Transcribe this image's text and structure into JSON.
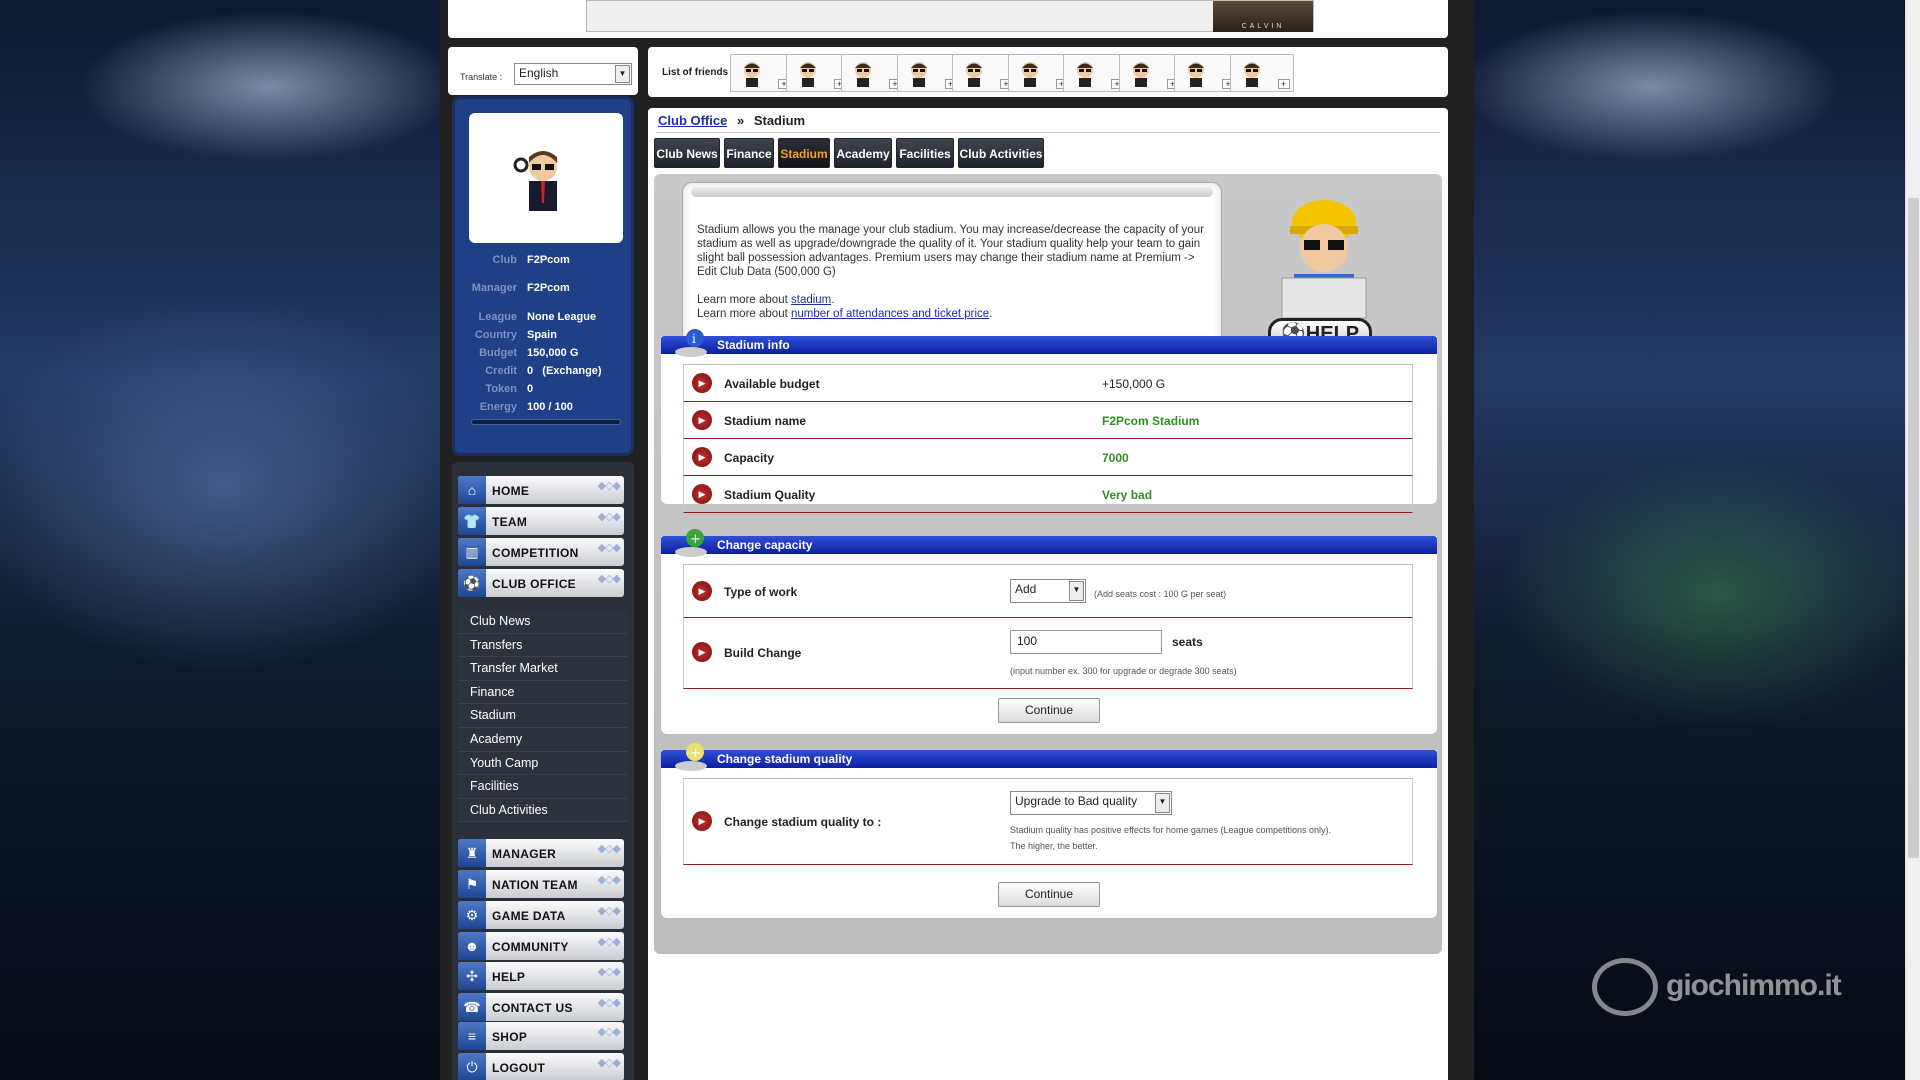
{
  "banner": {
    "ad_caption": "CALVIN"
  },
  "translate": {
    "label": "Translate :",
    "language": "English"
  },
  "profile": {
    "fields": [
      {
        "key": "Club",
        "value": "F2Pcom"
      },
      {
        "key": "Manager",
        "value": "F2Pcom"
      },
      {
        "key": "League",
        "value": "None League"
      },
      {
        "key": "Country",
        "value": "Spain"
      },
      {
        "key": "Budget",
        "value": "150,000 G"
      },
      {
        "key": "Credit",
        "value": "0   (Exchange)"
      },
      {
        "key": "Token",
        "value": "0"
      },
      {
        "key": "Energy",
        "value": "100 / 100"
      }
    ],
    "energy_level": 1.0
  },
  "menu": {
    "top": [
      {
        "label": "HOME",
        "icon": "home-icon"
      },
      {
        "label": "TEAM",
        "icon": "shirt-icon"
      },
      {
        "label": "COMPETITION",
        "icon": "podium-icon"
      },
      {
        "label": "CLUB OFFICE",
        "icon": "ball-icon"
      }
    ],
    "sub": [
      "Club News",
      "Transfers",
      "Transfer Market",
      "Finance",
      "Stadium",
      "Academy",
      "Youth Camp",
      "Facilities",
      "Club Activities"
    ],
    "bottom": [
      {
        "label": "MANAGER",
        "icon": "manager-icon"
      },
      {
        "label": "NATION TEAM",
        "icon": "flag-icon"
      },
      {
        "label": "GAME DATA",
        "icon": "gear-icon"
      },
      {
        "label": "COMMUNITY",
        "icon": "community-icon"
      },
      {
        "label": "HELP",
        "icon": "help-icon"
      },
      {
        "label": "CONTACT US",
        "icon": "phone-icon"
      },
      {
        "label": "SHOP",
        "icon": "cart-icon"
      },
      {
        "label": "LOGOUT",
        "icon": "power-icon"
      }
    ]
  },
  "friends": {
    "label": "List of friends",
    "count": 10,
    "plus": "+"
  },
  "breadcrumb": {
    "parent": "Club Office",
    "sep": "»",
    "current": "Stadium"
  },
  "tabs": [
    "Club News",
    "Finance",
    "Stadium",
    "Academy",
    "Facilities",
    "Club Activities"
  ],
  "intro": {
    "text": "Stadium allows you the manage your club stadium. You may increase/decrease the capacity of your stadium as well as upgrade/downgrade the quality of it. Your stadium quality help your team to gain slight ball possession advantages. Premium users may change their stadium name at Premium -> Edit Club Data (500,000 G)",
    "learn_prefix": "Learn more about",
    "link1": "stadium",
    "link2": "number of attendances and ticket price",
    "help_label": "HELP"
  },
  "stadium_info": {
    "title": "Stadium info",
    "rows": [
      {
        "key": "Available budget",
        "value": "+150,000 G"
      },
      {
        "key": "Stadium name",
        "value": "F2Pcom Stadium"
      },
      {
        "key": "Capacity",
        "value": "7000"
      },
      {
        "key": "Stadium Quality",
        "value": "Very bad"
      }
    ]
  },
  "change_capacity": {
    "title": "Change capacity",
    "type_label": "Type of work",
    "type_value": "Add",
    "type_note": "(Add seats cost : 100 G per seat)",
    "build_label": "Build Change",
    "build_value": "100",
    "build_unit": "seats",
    "build_note": "(input number ex. 300 for upgrade or degrade 300 seats)",
    "continue": "Continue"
  },
  "change_quality": {
    "title": "Change stadium quality",
    "label": "Change stadium quality to :",
    "value": "Upgrade to Bad quality",
    "note1": "Stadium quality has positive effects for home games (League competitions only).",
    "note2": "The higher, the better.",
    "continue": "Continue"
  },
  "watermark": "giochimmo.it"
}
